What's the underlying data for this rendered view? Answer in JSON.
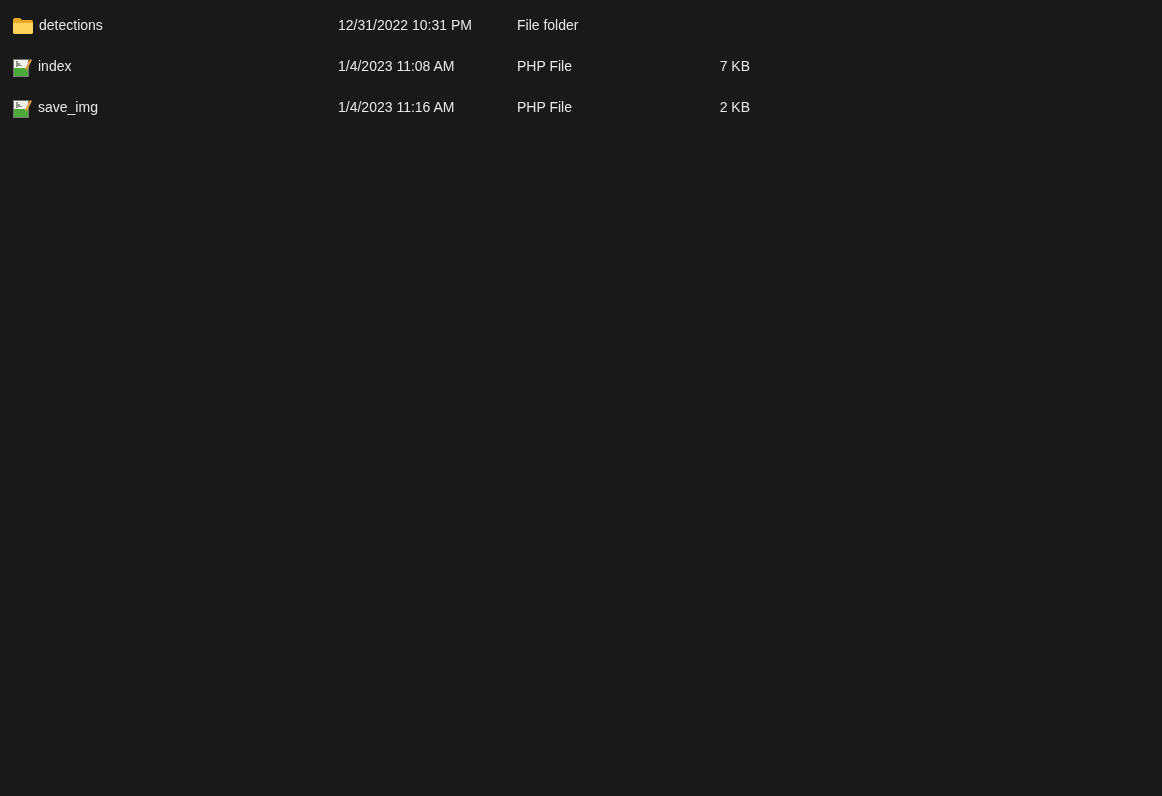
{
  "files": [
    {
      "kind": "folder",
      "name": "detections",
      "date_modified": "12/31/2022 10:31 PM",
      "type": "File folder"
    },
    {
      "kind": "php",
      "name": "index",
      "date_modified": "1/4/2023 11:08 AM",
      "type": "PHP File",
      "size": "7 KB"
    },
    {
      "kind": "php",
      "name": "save_img",
      "date_modified": "1/4/2023 11:16 AM",
      "type": "PHP File",
      "size": "2 KB"
    }
  ]
}
